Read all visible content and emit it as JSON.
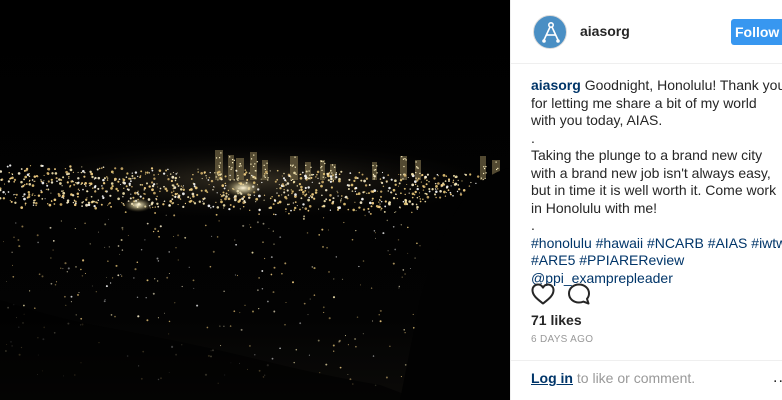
{
  "post": {
    "image_alt": "Night view of Honolulu city lights",
    "account": {
      "username": "aiasorg",
      "follow_label": "Follow"
    },
    "caption": {
      "author": "aiasorg",
      "line1": "Goodnight, Honolulu! Thank you",
      "line2": "for letting me share a bit of my world",
      "line3": "with you today, AIAS.",
      "sep1": ".",
      "line4": "Taking the plunge to a brand new city",
      "line5": "with a brand new job isn't always easy,",
      "line6": "but in time it is well worth it. Come work",
      "line7": "in Honolulu with me!",
      "sep2": ".",
      "tags_line1": [
        "#honolulu",
        "#hawaii",
        "#NCARB",
        "#AIAS",
        "#iwtwi"
      ],
      "tags_line2": [
        "#ARE5",
        "#PPIAREReview"
      ],
      "mention": "@ppi_examprepleader"
    },
    "likes": "71 likes",
    "time_ago": "6 DAYS AGO",
    "footer": {
      "login_label": "Log in",
      "rest": "to like or comment.",
      "more_label": "..."
    },
    "icons": {
      "like": "heart-icon",
      "comment": "comment-icon",
      "avatar": "aias-logo-icon",
      "more": "more-options-icon"
    },
    "colors": {
      "link": "#003569",
      "button": "#3897f0",
      "meta": "#999999"
    }
  }
}
